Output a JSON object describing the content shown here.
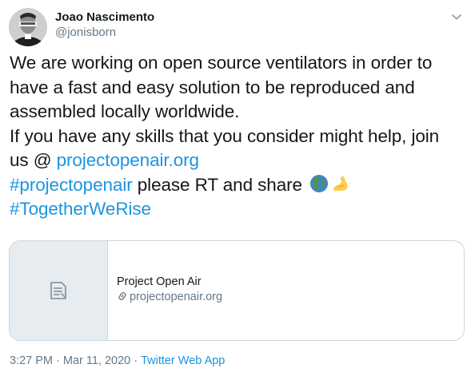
{
  "author": {
    "name": "Joao Nascimento",
    "handle": "@jonisborn"
  },
  "tweet": {
    "line1": "We are working on open source ventilators in order to",
    "line2": "have a fast and easy solution to be reproduced and",
    "line3": "assembled locally worldwide.",
    "line4": "If you have any skills that you consider might help, join",
    "line5_prefix": "us @ ",
    "link_url": "projectopenair.org",
    "hashtag1": "#projectopenair",
    "line6_text": " please RT and share ",
    "hashtag2": "#TogetherWeRise",
    "emojis": [
      "globe-europe-africa-emoji",
      "flexed-biceps-emoji"
    ]
  },
  "card": {
    "title": "Project Open Air",
    "domain": "projectopenair.org",
    "thumbnail_icon": "document-icon"
  },
  "meta": {
    "time": "3:27 PM",
    "separator": "·",
    "date": "Mar 11, 2020",
    "source": "Twitter Web App"
  },
  "colors": {
    "link": "#1b95e0",
    "text": "#14171a",
    "secondary": "#657786",
    "border": "#ccd6dd"
  }
}
